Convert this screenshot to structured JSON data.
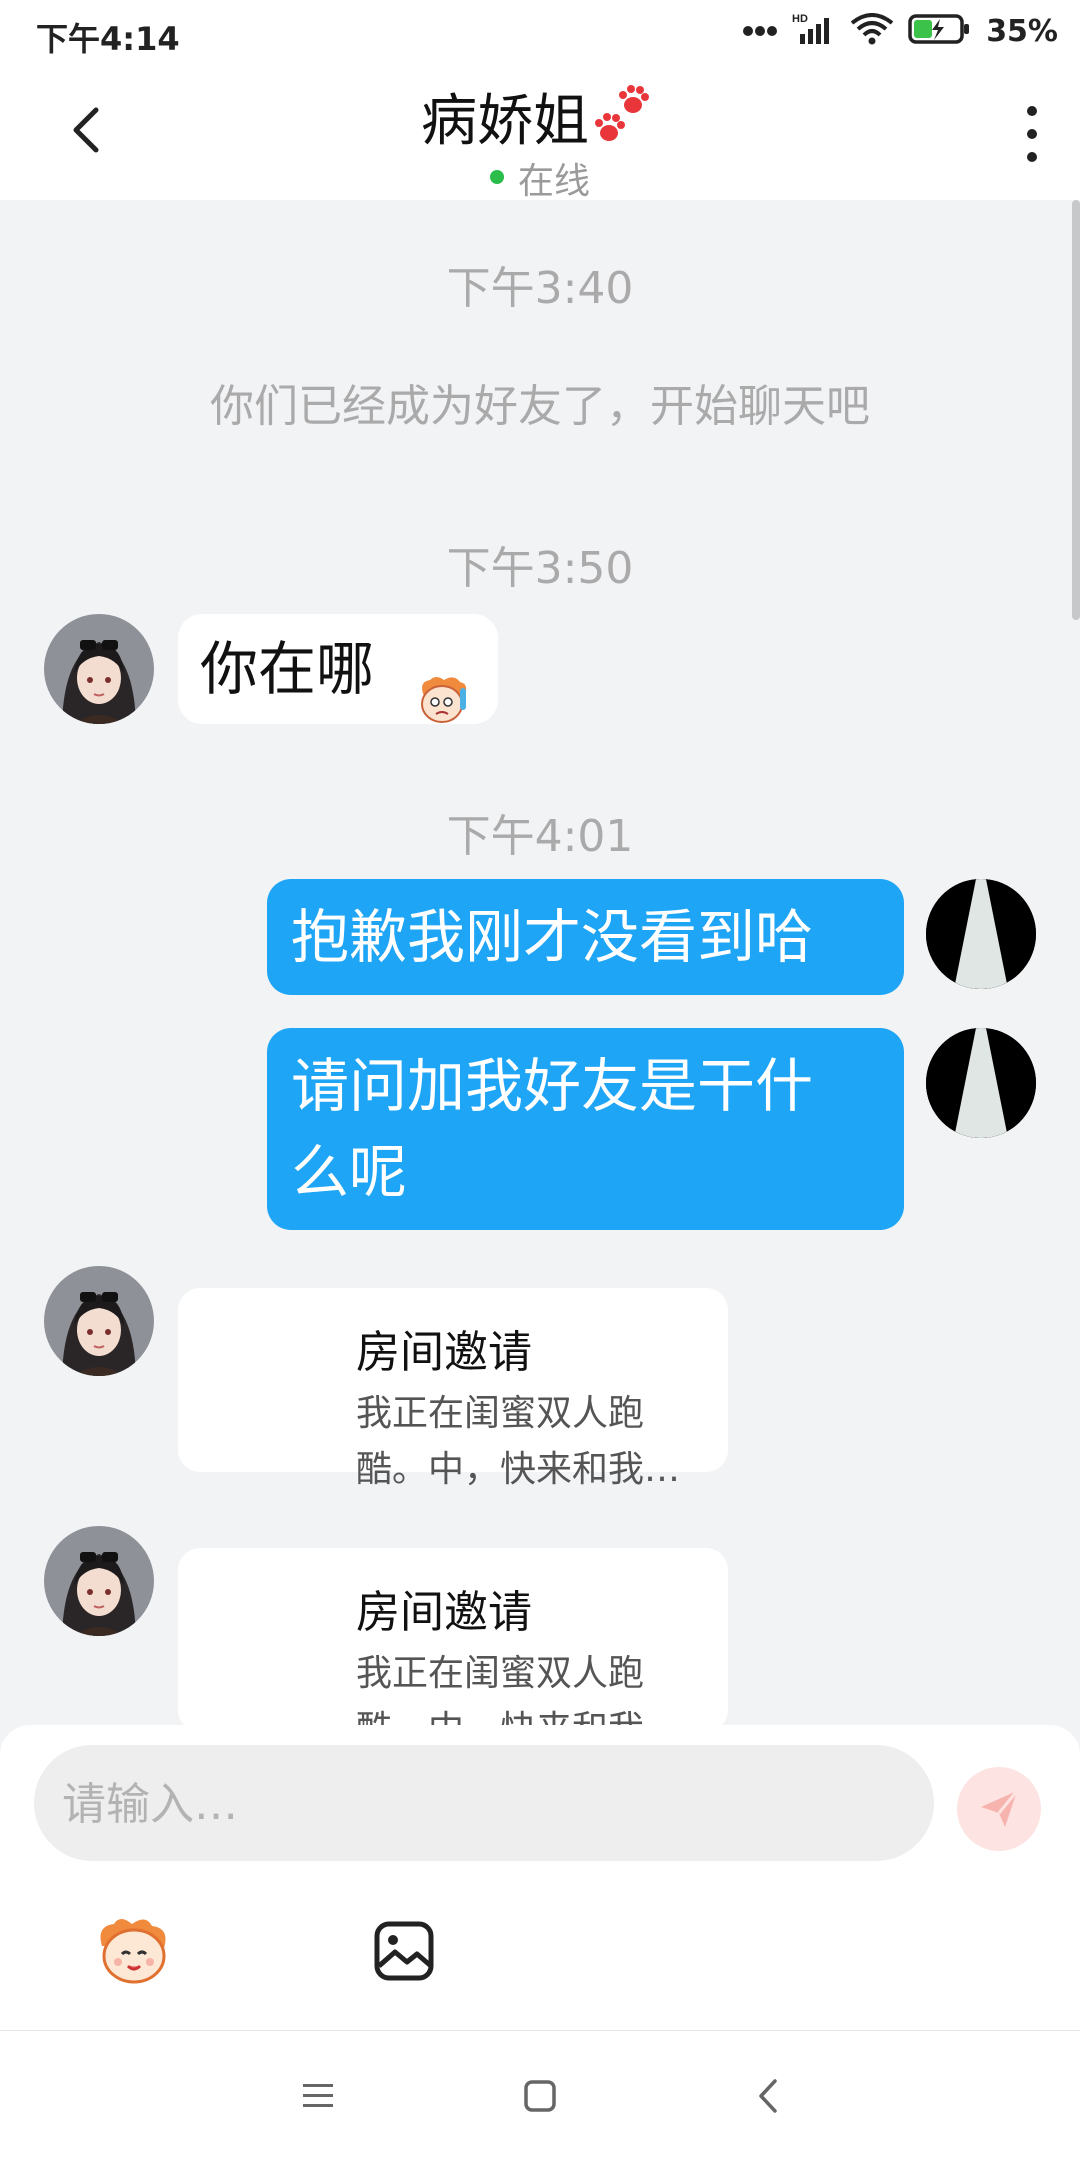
{
  "status": {
    "time": "下午4:14",
    "battery": "35%",
    "network": "HD"
  },
  "header": {
    "title": "病娇姐",
    "status": "在线"
  },
  "chat": {
    "system_notice": "你们已经成为好友了，开始聊天吧",
    "timestamps": [
      "下午3:40",
      "下午3:50",
      "下午4:01"
    ],
    "messages": [
      {
        "side": "in",
        "text": "你在哪"
      },
      {
        "side": "out",
        "text": "抱歉我刚才没看到哈"
      },
      {
        "side": "out",
        "line1": "请问加我好友是干什",
        "line2": "么呢"
      }
    ],
    "cards": [
      {
        "title": "房间邀请",
        "desc": "我正在闺蜜双人跑酷。中，快来和我…"
      },
      {
        "title": "房间邀请",
        "desc": "我正在闺蜜双人跑酷。中，快来和我…"
      }
    ]
  },
  "input": {
    "placeholder": "请输入…"
  },
  "icons": {
    "back": "chevron-left-icon",
    "more": "more-vertical-icon",
    "paw": "paw-icon",
    "send": "send-icon",
    "emoji": "emoji-icon",
    "image": "image-icon"
  },
  "colors": {
    "accent": "#1ea5f5",
    "online": "#2bbd4a",
    "send_bg": "#fde3e1"
  }
}
